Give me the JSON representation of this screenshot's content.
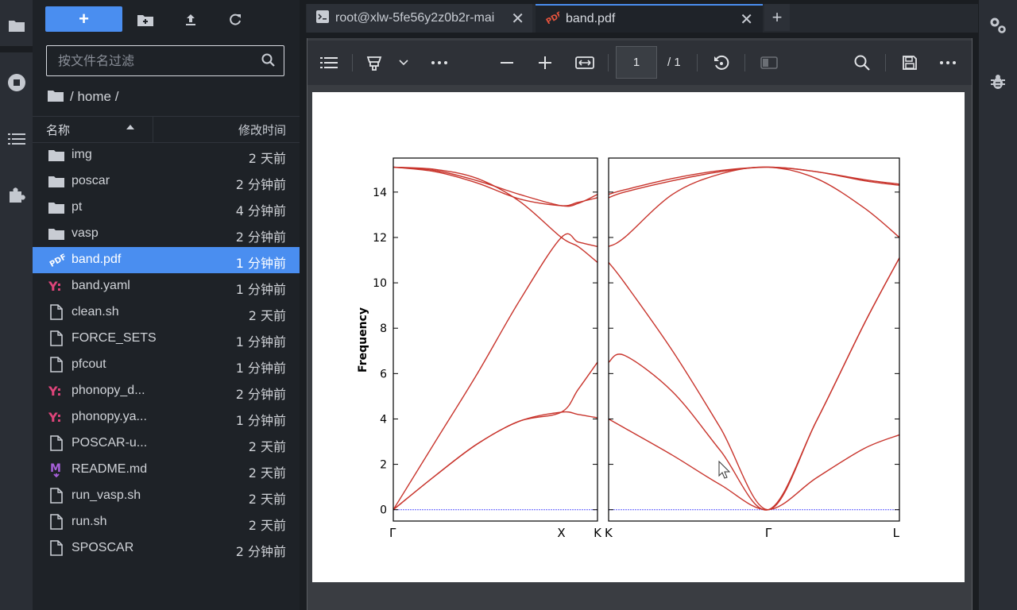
{
  "toolbar": {
    "new_label": "+"
  },
  "search": {
    "placeholder": "按文件名过滤"
  },
  "breadcrumb": {
    "path": "/ home /"
  },
  "columns": {
    "name": "名称",
    "modified": "修改时间"
  },
  "files": [
    {
      "name": "img",
      "time": "2 天前",
      "icon": "folder-icon"
    },
    {
      "name": "poscar",
      "time": "2 分钟前",
      "icon": "folder-icon"
    },
    {
      "name": "pt",
      "time": "4 分钟前",
      "icon": "folder-icon"
    },
    {
      "name": "vasp",
      "time": "2 分钟前",
      "icon": "folder-icon"
    },
    {
      "name": "band.pdf",
      "time": "1 分钟前",
      "icon": "pdf-icon",
      "selected": true
    },
    {
      "name": "band.yaml",
      "time": "1 分钟前",
      "icon": "yaml-icon"
    },
    {
      "name": "clean.sh",
      "time": "2 天前",
      "icon": "file-icon"
    },
    {
      "name": "FORCE_SETS",
      "time": "1 分钟前",
      "icon": "file-icon"
    },
    {
      "name": "pfcout",
      "time": "1 分钟前",
      "icon": "file-icon"
    },
    {
      "name": "phonopy_d...",
      "time": "2 分钟前",
      "icon": "yaml-icon"
    },
    {
      "name": "phonopy.ya...",
      "time": "1 分钟前",
      "icon": "yaml-icon"
    },
    {
      "name": "POSCAR-u...",
      "time": "2 天前",
      "icon": "file-icon"
    },
    {
      "name": "README.md",
      "time": "2 天前",
      "icon": "markdown-icon"
    },
    {
      "name": "run_vasp.sh",
      "time": "2 天前",
      "icon": "file-icon"
    },
    {
      "name": "run.sh",
      "time": "2 天前",
      "icon": "file-icon"
    },
    {
      "name": "SPOSCAR",
      "time": "2 分钟前",
      "icon": "file-icon"
    }
  ],
  "tabs": [
    {
      "title": "root@xlw-5fe56y2z0b2r-mai",
      "icon": "terminal-icon"
    },
    {
      "title": "band.pdf",
      "icon": "pdf-icon",
      "active": true
    }
  ],
  "pdf_toolbar": {
    "page_current": "1",
    "page_total": "/ 1"
  },
  "colors": {
    "accent": "#4a8ef0",
    "band_line": "#c8342c",
    "zero_line": "#5a5aff"
  },
  "chart_data": [
    {
      "type": "line",
      "ylabel": "Frequency",
      "ylim": [
        -0.5,
        15.5
      ],
      "yticks": [
        "0",
        "2",
        "4",
        "6",
        "8",
        "10",
        "12",
        "14"
      ],
      "xticks": [
        "Γ",
        "X",
        "K"
      ],
      "x_positions": [
        0,
        1,
        1.215
      ],
      "series": [
        {
          "x": [
            0,
            0.25,
            0.5,
            0.75,
            1,
            1.1,
            1.215
          ],
          "y": [
            0,
            3.0,
            6.0,
            9.2,
            12.0,
            11.8,
            11.6
          ]
        },
        {
          "x": [
            0,
            0.25,
            0.5,
            0.75,
            1,
            1.1,
            1.215
          ],
          "y": [
            0,
            1.5,
            2.9,
            3.9,
            4.3,
            4.2,
            4.05
          ]
        },
        {
          "x": [
            0,
            0.25,
            0.5,
            0.75,
            1,
            1.1,
            1.215
          ],
          "y": [
            0,
            1.5,
            2.9,
            3.9,
            4.3,
            5.3,
            6.5
          ]
        },
        {
          "x": [
            0,
            0.25,
            0.5,
            0.75,
            1,
            1.1,
            1.215
          ],
          "y": [
            15.1,
            14.9,
            14.4,
            13.7,
            13.4,
            13.55,
            13.75
          ]
        },
        {
          "x": [
            0,
            0.25,
            0.5,
            0.75,
            1,
            1.1,
            1.215
          ],
          "y": [
            15.1,
            15.0,
            14.6,
            13.6,
            12.0,
            11.6,
            10.9
          ]
        },
        {
          "x": [
            0,
            0.25,
            0.5,
            0.75,
            1,
            1.1,
            1.215
          ],
          "y": [
            15.1,
            14.95,
            14.5,
            13.9,
            13.4,
            13.5,
            13.9
          ]
        }
      ]
    },
    {
      "type": "line",
      "ylim": [
        -0.5,
        15.5
      ],
      "xticks": [
        "K",
        "Γ",
        "L"
      ],
      "x_positions": [
        0,
        1.0,
        1.82
      ],
      "series": [
        {
          "x": [
            0,
            0.1,
            0.4,
            0.7,
            1.0,
            1.3,
            1.6,
            1.82
          ],
          "y": [
            4.0,
            3.6,
            2.4,
            1.1,
            0,
            1.4,
            2.7,
            3.3
          ]
        },
        {
          "x": [
            0,
            0.1,
            0.4,
            0.7,
            1.0,
            1.3,
            1.6,
            1.82
          ],
          "y": [
            6.5,
            6.8,
            5.2,
            2.6,
            0,
            3.9,
            8.2,
            11.1
          ]
        },
        {
          "x": [
            0,
            0.1,
            0.4,
            0.7,
            1.0,
            1.3,
            1.6,
            1.82
          ],
          "y": [
            10.9,
            10.0,
            7.0,
            3.6,
            0,
            3.9,
            8.2,
            11.1
          ]
        },
        {
          "x": [
            0,
            0.1,
            0.4,
            0.7,
            1.0,
            1.3,
            1.6,
            1.82
          ],
          "y": [
            11.6,
            12.0,
            13.9,
            14.8,
            15.1,
            14.6,
            13.3,
            12.0
          ]
        },
        {
          "x": [
            0,
            0.1,
            0.4,
            0.7,
            1.0,
            1.3,
            1.6,
            1.82
          ],
          "y": [
            13.75,
            14.0,
            14.5,
            14.9,
            15.1,
            14.9,
            14.5,
            14.3
          ]
        },
        {
          "x": [
            0,
            0.1,
            0.4,
            0.7,
            1.0,
            1.3,
            1.6,
            1.82
          ],
          "y": [
            13.9,
            14.1,
            14.6,
            14.95,
            15.1,
            14.9,
            14.55,
            14.35
          ]
        }
      ]
    }
  ]
}
